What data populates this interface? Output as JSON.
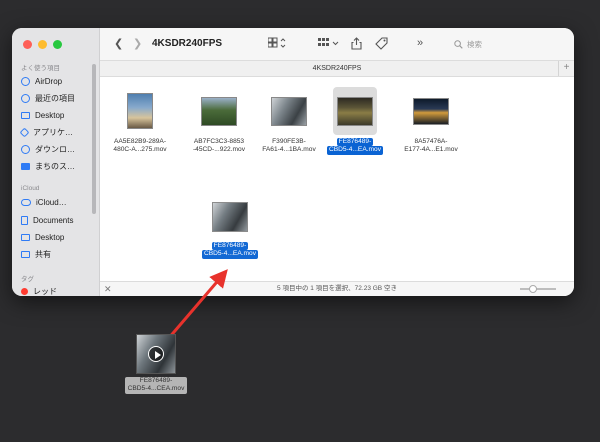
{
  "window": {
    "title": "4KSDR240FPS",
    "path_title": "4KSDR240FPS",
    "search_placeholder": "検索",
    "plus": "+"
  },
  "sidebar": {
    "favorites_header": "よく使う項目",
    "favorites": [
      {
        "label": "AirDrop",
        "icon": "airdrop-icon"
      },
      {
        "label": "最近の項目",
        "icon": "clock-icon"
      },
      {
        "label": "Desktop",
        "icon": "desktop-icon"
      },
      {
        "label": "アプリケ…",
        "icon": "applications-icon"
      },
      {
        "label": "ダウンロ…",
        "icon": "download-icon"
      },
      {
        "label": "まちのス…",
        "icon": "folder-icon"
      }
    ],
    "icloud_header": "iCloud",
    "icloud": [
      {
        "label": "iCloud…",
        "icon": "icloud-icon"
      },
      {
        "label": "Documents",
        "icon": "documents-icon"
      },
      {
        "label": "Desktop",
        "icon": "desktop-icon"
      },
      {
        "label": "共有",
        "icon": "shared-icon"
      }
    ],
    "tags_header": "タグ",
    "tags": [
      {
        "label": "レッド",
        "color": "#ff3b30"
      }
    ]
  },
  "files": [
    {
      "line1": "AA5E82B9-289A-",
      "line2": "480C-A...275.mov",
      "selected": false
    },
    {
      "line1": "AB7FC3C3-8853",
      "line2": "-45CD-...922.mov",
      "selected": false
    },
    {
      "line1": "F390FE3B-",
      "line2": "FA61-4...1BA.mov",
      "selected": false
    },
    {
      "line1": "FE876489-",
      "line2": "CBD5-4...EA.mov",
      "selected": true
    },
    {
      "line1": "8A57476A-",
      "line2": "E177-4A...E1.mov",
      "selected": false
    }
  ],
  "drag_ghost": {
    "line1": "FE876489-",
    "line2": "CBD5-4...EA.mov"
  },
  "desktop_file": {
    "line1": "FE876489-",
    "line2": "CBD5-4...CEA.mov"
  },
  "status": {
    "text": "5 項目中の 1 項目を選択、72.23 GB 空き",
    "close": "✕",
    "zoom_level": 0.35
  },
  "colors": {
    "selection": "#0a63d3",
    "arrow": "#e8322c",
    "desktop_bg": "#2c2c2e"
  }
}
